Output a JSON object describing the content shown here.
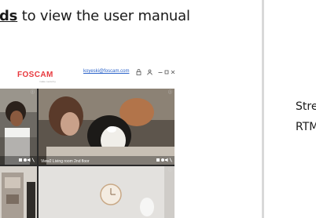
{
  "instruction": {
    "keyword": "ds",
    "rest": " to view the user manual"
  },
  "side_text": {
    "line1": "Stre",
    "line2": "RTM"
  },
  "app": {
    "logo": "FOSCAM",
    "logo_sub": "make security",
    "account": "koyeski@foscam.com",
    "icons": {
      "lock": "lock-icon",
      "user": "user-icon",
      "minimize": "minimize-icon",
      "maximize": "maximize-icon",
      "close": "close-icon"
    },
    "tiles": [
      {
        "label": "",
        "controls": "camera, snapshot, audio, settings"
      },
      {
        "label": "View2 Living room 2nd floor",
        "controls": "camera, snapshot, audio, settings"
      },
      {
        "label": "",
        "controls": ""
      },
      {
        "label": "",
        "controls": ""
      }
    ]
  },
  "colors": {
    "logo": "#e8383d",
    "account_link": "#2a62c9",
    "divider": "#d9d9d9"
  }
}
